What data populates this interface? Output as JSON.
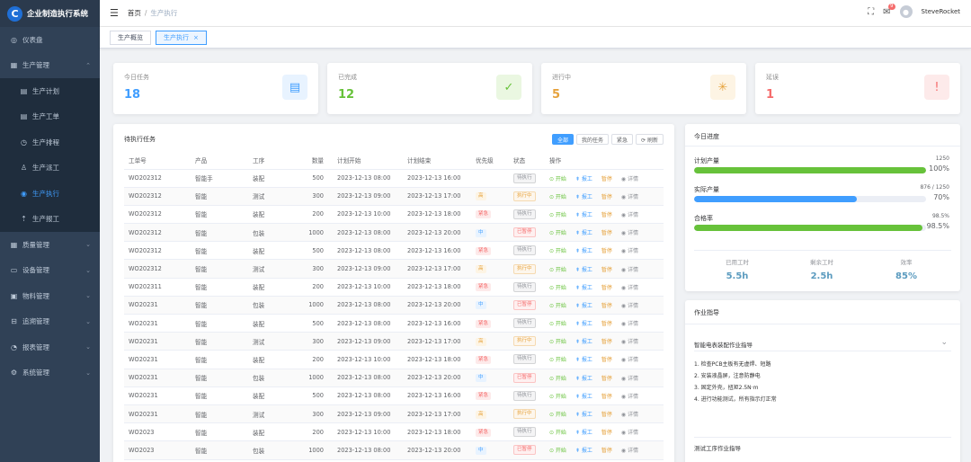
{
  "app": {
    "title": "企业制造执行系统",
    "logo_letter": "C"
  },
  "sidebar": {
    "items": [
      {
        "label": "仪表盘",
        "icon": "dashboard-icon",
        "glyph": "◎",
        "sub": false,
        "arrow": ""
      },
      {
        "label": "生产管理",
        "icon": "production-icon",
        "glyph": "▦",
        "sub": false,
        "arrow": "⌃"
      },
      {
        "label": "生产计划",
        "icon": "document-icon",
        "glyph": "▤",
        "sub": true,
        "arrow": ""
      },
      {
        "label": "生产工单",
        "icon": "document-icon",
        "glyph": "▤",
        "sub": true,
        "arrow": ""
      },
      {
        "label": "生产排程",
        "icon": "clock-icon",
        "glyph": "◷",
        "sub": true,
        "arrow": ""
      },
      {
        "label": "生产派工",
        "icon": "user-icon",
        "glyph": "♙",
        "sub": true,
        "arrow": ""
      },
      {
        "label": "生产执行",
        "icon": "target-icon",
        "glyph": "◉",
        "sub": true,
        "arrow": "",
        "active": true
      },
      {
        "label": "生产报工",
        "icon": "upload-icon",
        "glyph": "⇡",
        "sub": true,
        "arrow": ""
      },
      {
        "label": "质量管理",
        "icon": "quality-icon",
        "glyph": "▦",
        "sub": false,
        "arrow": "⌄"
      },
      {
        "label": "设备管理",
        "icon": "monitor-icon",
        "glyph": "▭",
        "sub": false,
        "arrow": "⌄"
      },
      {
        "label": "物料管理",
        "icon": "box-icon",
        "glyph": "▣",
        "sub": false,
        "arrow": "⌄"
      },
      {
        "label": "追溯管理",
        "icon": "link-icon",
        "glyph": "⊟",
        "sub": false,
        "arrow": "⌄"
      },
      {
        "label": "报表管理",
        "icon": "report-icon",
        "glyph": "◔",
        "sub": false,
        "arrow": "⌄"
      },
      {
        "label": "系统管理",
        "icon": "gear-icon",
        "glyph": "⚙",
        "sub": false,
        "arrow": "⌄"
      }
    ]
  },
  "header": {
    "breadcrumb_home": "首页",
    "breadcrumb_sep": "/",
    "breadcrumb_current": "生产执行",
    "notification_count": "9",
    "username": "SteveRocket"
  },
  "tags": [
    {
      "label": "生产概览",
      "active": false
    },
    {
      "label": "生产执行",
      "active": true,
      "close": "×"
    }
  ],
  "stats": [
    {
      "label": "今日任务",
      "value": "18",
      "color": "#409eff",
      "icon": "document-icon",
      "glyph": "▤",
      "bg": "#e8f3ff"
    },
    {
      "label": "已完成",
      "value": "12",
      "color": "#67c23a",
      "icon": "check-icon",
      "glyph": "✓",
      "bg": "#eaf7e1"
    },
    {
      "label": "进行中",
      "value": "5",
      "color": "#e6a23c",
      "icon": "loading-icon",
      "glyph": "✳",
      "bg": "#fdf4e4"
    },
    {
      "label": "延误",
      "value": "1",
      "color": "#f56c6c",
      "icon": "warning-icon",
      "glyph": "!",
      "bg": "#fdeaea"
    }
  ],
  "tasks": {
    "title": "待执行任务",
    "filters": [
      {
        "label": "全部",
        "active": true
      },
      {
        "label": "我的任务",
        "active": false
      },
      {
        "label": "紧急",
        "active": false
      },
      {
        "label": "⟳ 刷新",
        "active": false
      }
    ],
    "columns": [
      "工单号",
      "产品",
      "工序",
      "数量",
      "计划开始",
      "计划结束",
      "优先级",
      "状态",
      "操作"
    ],
    "actions": {
      "start": "⊙ 开始",
      "report": "⇞ 报工",
      "pause": "暂停",
      "detail": "◉ 详情"
    },
    "rows": [
      {
        "id": "WO202312",
        "product": "智能手",
        "process": "装配",
        "qty": "500",
        "start": "2023-12-13 08:00",
        "end": "2023-12-13 16:00",
        "priority": "",
        "status": "待执行"
      },
      {
        "id": "WO202312",
        "product": "智能",
        "process": "测试",
        "qty": "300",
        "start": "2023-12-13 09:00",
        "end": "2023-12-13 17:00",
        "priority": "高",
        "status": "执行中"
      },
      {
        "id": "WO202312",
        "product": "智能",
        "process": "装配",
        "qty": "200",
        "start": "2023-12-13 10:00",
        "end": "2023-12-13 18:00",
        "priority": "紧急",
        "status": "待执行"
      },
      {
        "id": "WO202312",
        "product": "智能",
        "process": "包装",
        "qty": "1000",
        "start": "2023-12-13 08:00",
        "end": "2023-12-13 20:00",
        "priority": "中",
        "status": "已暂停"
      },
      {
        "id": "WO202312",
        "product": "智能",
        "process": "装配",
        "qty": "500",
        "start": "2023-12-13 08:00",
        "end": "2023-12-13 16:00",
        "priority": "紧急",
        "status": "待执行"
      },
      {
        "id": "WO202312",
        "product": "智能",
        "process": "测试",
        "qty": "300",
        "start": "2023-12-13 09:00",
        "end": "2023-12-13 17:00",
        "priority": "高",
        "status": "执行中"
      },
      {
        "id": "WO202311",
        "product": "智能",
        "process": "装配",
        "qty": "200",
        "start": "2023-12-13 10:00",
        "end": "2023-12-13 18:00",
        "priority": "紧急",
        "status": "待执行"
      },
      {
        "id": "WO20231",
        "product": "智能",
        "process": "包装",
        "qty": "1000",
        "start": "2023-12-13 08:00",
        "end": "2023-12-13 20:00",
        "priority": "中",
        "status": "已暂停"
      },
      {
        "id": "WO20231",
        "product": "智能",
        "process": "装配",
        "qty": "500",
        "start": "2023-12-13 08:00",
        "end": "2023-12-13 16:00",
        "priority": "紧急",
        "status": "待执行"
      },
      {
        "id": "WO20231",
        "product": "智能",
        "process": "测试",
        "qty": "300",
        "start": "2023-12-13 09:00",
        "end": "2023-12-13 17:00",
        "priority": "高",
        "status": "执行中"
      },
      {
        "id": "WO20231",
        "product": "智能",
        "process": "装配",
        "qty": "200",
        "start": "2023-12-13 10:00",
        "end": "2023-12-13 18:00",
        "priority": "紧急",
        "status": "待执行"
      },
      {
        "id": "WO20231",
        "product": "智能",
        "process": "包装",
        "qty": "1000",
        "start": "2023-12-13 08:00",
        "end": "2023-12-13 20:00",
        "priority": "中",
        "status": "已暂停"
      },
      {
        "id": "WO20231",
        "product": "智能",
        "process": "装配",
        "qty": "500",
        "start": "2023-12-13 08:00",
        "end": "2023-12-13 16:00",
        "priority": "紧急",
        "status": "待执行"
      },
      {
        "id": "WO20231",
        "product": "智能",
        "process": "测试",
        "qty": "300",
        "start": "2023-12-13 09:00",
        "end": "2023-12-13 17:00",
        "priority": "高",
        "status": "执行中"
      },
      {
        "id": "WO2023",
        "product": "智能",
        "process": "装配",
        "qty": "200",
        "start": "2023-12-13 10:00",
        "end": "2023-12-13 18:00",
        "priority": "紧急",
        "status": "待执行"
      },
      {
        "id": "WO2023",
        "product": "智能",
        "process": "包装",
        "qty": "1000",
        "start": "2023-12-13 08:00",
        "end": "2023-12-13 20:00",
        "priority": "中",
        "status": "已暂停"
      }
    ]
  },
  "progress": {
    "title": "今日进度",
    "bars": [
      {
        "label": "计划产量",
        "amount": "1250",
        "pct_text": "100%",
        "fraction": 1.0,
        "color": "#67c23a"
      },
      {
        "label": "实际产量",
        "amount": "876 / 1250",
        "pct_text": "70%",
        "fraction": 0.7,
        "color": "#409eff"
      },
      {
        "label": "合格率",
        "amount": "98.5%",
        "pct_text": "98.5%",
        "fraction": 0.985,
        "color": "#67c23a"
      }
    ],
    "metrics": [
      {
        "label": "已用工时",
        "value": "5.5h"
      },
      {
        "label": "剩余工时",
        "value": "2.5h"
      },
      {
        "label": "效率",
        "value": "85%"
      }
    ]
  },
  "guide": {
    "title": "作业指导",
    "item_title": "智能电表装配作业指导",
    "chevron": "⌄",
    "steps": [
      "1. 检查PCB主板有无虚焊、短路",
      "2. 安装液晶屏，注意防静电",
      "3. 固定外壳，扭矩2.5N·m",
      "4. 进行功能测试，所有指示灯正常"
    ],
    "item2_title": "测试工序作业指导"
  },
  "colors": {
    "priority": {
      "高": [
        "#fdf4e4",
        "#e6a23c"
      ],
      "紧急": [
        "#fdeaea",
        "#f56c6c"
      ],
      "中": [
        "#e8f3ff",
        "#409eff"
      ]
    },
    "status": {
      "待执行": [
        "#f4f4f5",
        "#909399",
        "#d3d4d6"
      ],
      "执行中": [
        "#fdf6ec",
        "#e6a23c",
        "#f5dab1"
      ],
      "已暂停": [
        "#fef0f0",
        "#f56c6c",
        "#fbc4c4"
      ]
    }
  }
}
